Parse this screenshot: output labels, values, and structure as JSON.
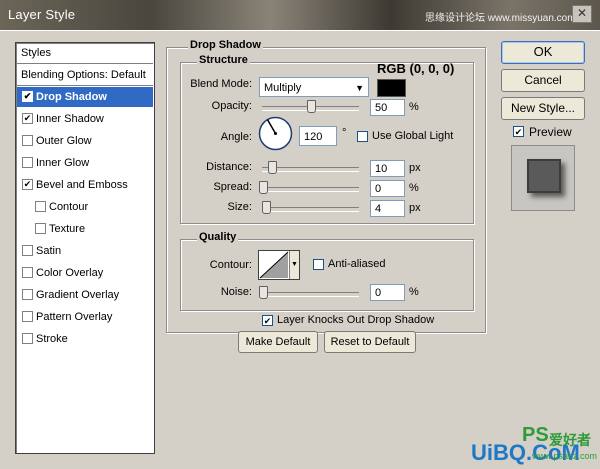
{
  "window": {
    "title": "Layer Style",
    "site_text": "思缘设计论坛  www.missyuan.com",
    "close_glyph": "✕"
  },
  "styles_list": {
    "header": "Styles",
    "blending_options": "Blending Options: Default",
    "items": [
      {
        "label": "Drop Shadow",
        "checked": true,
        "selected": true,
        "indent": false
      },
      {
        "label": "Inner Shadow",
        "checked": true,
        "selected": false,
        "indent": false
      },
      {
        "label": "Outer Glow",
        "checked": false,
        "selected": false,
        "indent": false
      },
      {
        "label": "Inner Glow",
        "checked": false,
        "selected": false,
        "indent": false
      },
      {
        "label": "Bevel and Emboss",
        "checked": true,
        "selected": false,
        "indent": false
      },
      {
        "label": "Contour",
        "checked": false,
        "selected": false,
        "indent": true
      },
      {
        "label": "Texture",
        "checked": false,
        "selected": false,
        "indent": true
      },
      {
        "label": "Satin",
        "checked": false,
        "selected": false,
        "indent": false
      },
      {
        "label": "Color Overlay",
        "checked": false,
        "selected": false,
        "indent": false
      },
      {
        "label": "Gradient Overlay",
        "checked": false,
        "selected": false,
        "indent": false
      },
      {
        "label": "Pattern Overlay",
        "checked": false,
        "selected": false,
        "indent": false
      },
      {
        "label": "Stroke",
        "checked": false,
        "selected": false,
        "indent": false
      }
    ]
  },
  "drop_shadow": {
    "title": "Drop Shadow",
    "structure": {
      "title": "Structure",
      "rgb_annotation": "RGB (0, 0, 0)",
      "blend_mode_label": "Blend Mode:",
      "blend_mode_value": "Multiply",
      "color_swatch": "#000000",
      "opacity_label": "Opacity:",
      "opacity_value": "50",
      "opacity_level": 0.5,
      "opacity_unit": "%",
      "angle_label": "Angle:",
      "angle_value": "120",
      "angle_unit": "°",
      "use_global_light_label": "Use Global Light",
      "use_global_light": false,
      "distance_label": "Distance:",
      "distance_value": "10",
      "distance_unit": "px",
      "spread_label": "Spread:",
      "spread_value": "0",
      "spread_unit": "%",
      "size_label": "Size:",
      "size_value": "4",
      "size_unit": "px"
    },
    "quality": {
      "title": "Quality",
      "contour_label": "Contour:",
      "anti_aliased_label": "Anti-aliased",
      "anti_aliased": false,
      "noise_label": "Noise:",
      "noise_value": "0",
      "noise_unit": "%"
    },
    "knocks_out_label": "Layer Knocks Out Drop Shadow",
    "knocks_out": true,
    "make_default_label": "Make Default",
    "reset_default_label": "Reset to Default"
  },
  "actions": {
    "ok_label": "OK",
    "cancel_label": "Cancel",
    "new_style_label": "New Style...",
    "preview_label": "Preview",
    "preview_checked": true
  },
  "watermark": {
    "left_text": "UiBQ.CoM",
    "ps_text": "PS",
    "cn_text": "爱好者",
    "url_text": "www.psahz.com"
  },
  "colors": {
    "dialog_bg": "#d4d0c8",
    "selection": "#316ac5",
    "watermark_blue": "#1e78c8",
    "watermark_green": "#2e9a3a"
  }
}
